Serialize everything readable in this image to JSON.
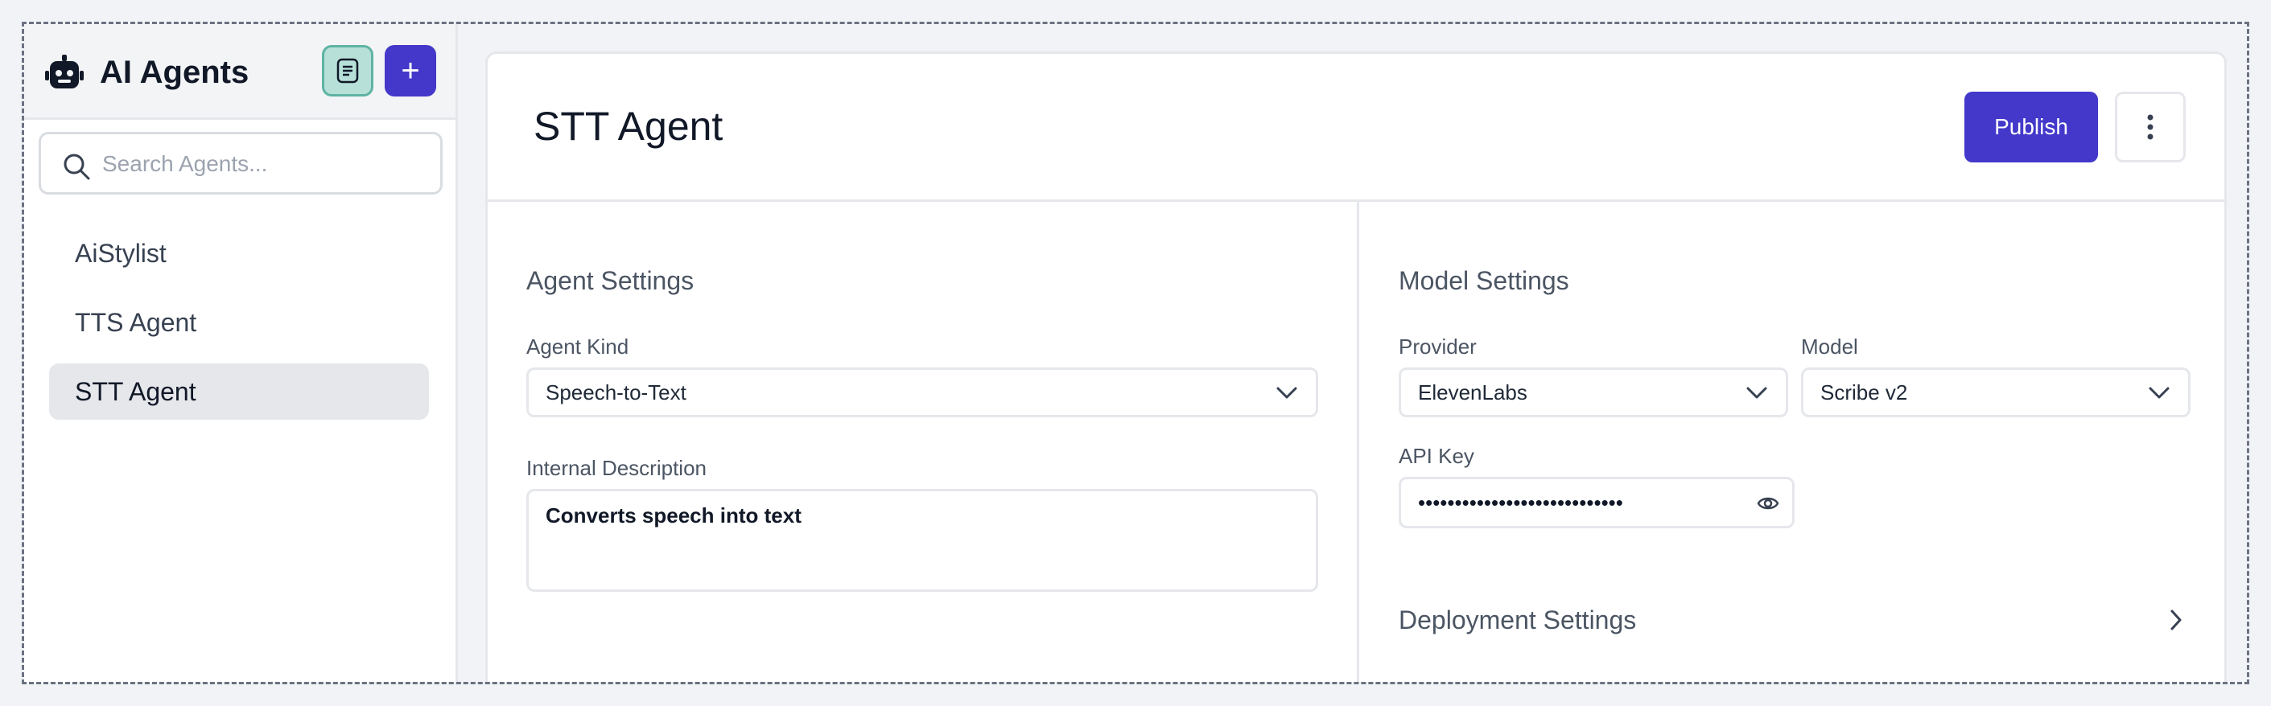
{
  "sidebar": {
    "title": "AI Agents",
    "search_placeholder": "Search Agents...",
    "add_label": "+",
    "agents": [
      {
        "label": "AiStylist",
        "active": false
      },
      {
        "label": "TTS Agent",
        "active": false
      },
      {
        "label": "STT Agent",
        "active": true
      }
    ]
  },
  "main": {
    "title": "STT Agent",
    "publish_label": "Publish",
    "agent_settings": {
      "title": "Agent Settings",
      "kind_label": "Agent Kind",
      "kind_value": "Speech-to-Text",
      "description_label": "Internal Description",
      "description_value": "Converts speech into text"
    },
    "model_settings": {
      "title": "Model Settings",
      "provider_label": "Provider",
      "provider_value": "ElevenLabs",
      "model_label": "Model",
      "model_value": "Scribe v2",
      "api_key_label": "API Key",
      "api_key_value": "••••••••••••••••••••••••••••"
    },
    "deployment_settings": {
      "title": "Deployment Settings"
    }
  },
  "icons": {
    "app": "robot-icon",
    "docs": "document-icon",
    "add": "plus-icon",
    "search": "search-icon",
    "more": "more-vertical-icon",
    "dropdown": "chevron-down-icon",
    "reveal": "eye-icon",
    "expand": "chevron-right-icon"
  },
  "colors": {
    "accent": "#4338ca",
    "docs_button": "#b6e0d8",
    "active_item": "#e5e7eb",
    "background": "#f1f3f7"
  }
}
